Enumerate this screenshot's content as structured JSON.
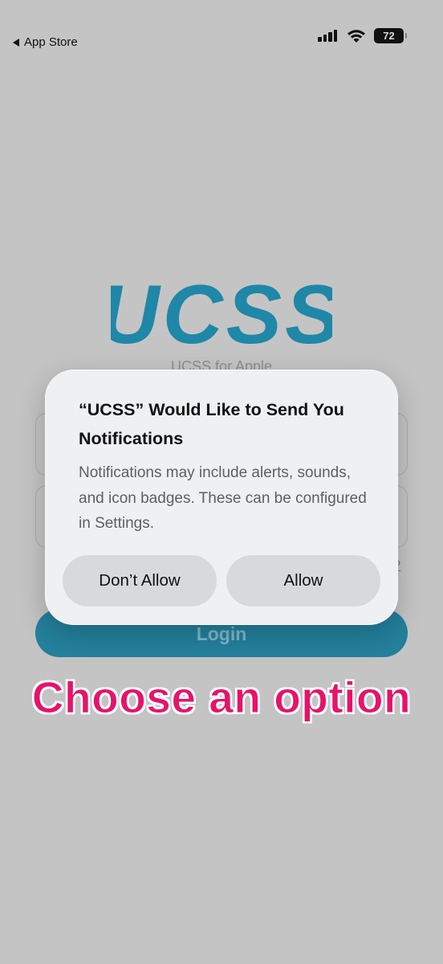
{
  "status_bar": {
    "back_label": "App Store",
    "battery": "72"
  },
  "app": {
    "logo_text": "UCSS",
    "logo_subtitle": "UCSS for Apple",
    "forgot_fragment": "l?",
    "login_label": "Login",
    "brand_color": "#1f87a8"
  },
  "alert": {
    "title": "“UCSS” Would Like to Send You Notifications",
    "message": "Notifications may include alerts, sounds, and icon badges. These can be configured in Settings.",
    "deny_label": "Don’t Allow",
    "allow_label": "Allow"
  },
  "annotation": {
    "text": "Choose an option",
    "color": "#e8126a"
  }
}
